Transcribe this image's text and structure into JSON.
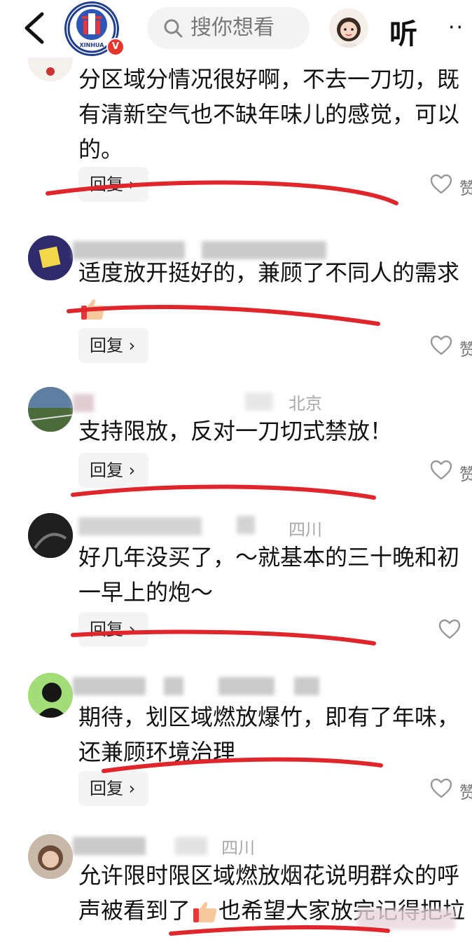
{
  "topbar": {
    "search_placeholder": "搜你想看",
    "listen_label": "听",
    "more_label": "··",
    "logo_text": "XINHUA"
  },
  "comments": [
    {
      "text": "分区域分情况很好啊，不去一刀切，既有清新空气也不缺年味儿的感觉，可以的。",
      "reply_label": "回复",
      "like_label": "赞"
    },
    {
      "text": "适度放开挺好的，兼顾了不同人的需求",
      "reply_label": "回复",
      "like_label": "赞"
    },
    {
      "location": "北京",
      "text": "支持限放，反对一刀切式禁放！",
      "reply_label": "回复",
      "like_label": "赞"
    },
    {
      "location": "四川",
      "text": "好几年没买了，～就基本的三十晚和初一早上的炮～",
      "reply_label": "回复",
      "like_label": ""
    },
    {
      "text": "期待，划区域燃放爆竹，即有了年味，还兼顾环境治理",
      "reply_label": "回复",
      "like_label": "赞"
    },
    {
      "location": "四川",
      "text_line1": "允许限时限区域燃放烟花说明群众的呼",
      "text_line2_a": "声被看到了",
      "text_line2_b": "也希望大家放完记得把垃"
    }
  ],
  "colors": {
    "underline_red": "#e0262b",
    "logo_blue": "#1f3e8f",
    "badge_red": "#e8352e"
  }
}
